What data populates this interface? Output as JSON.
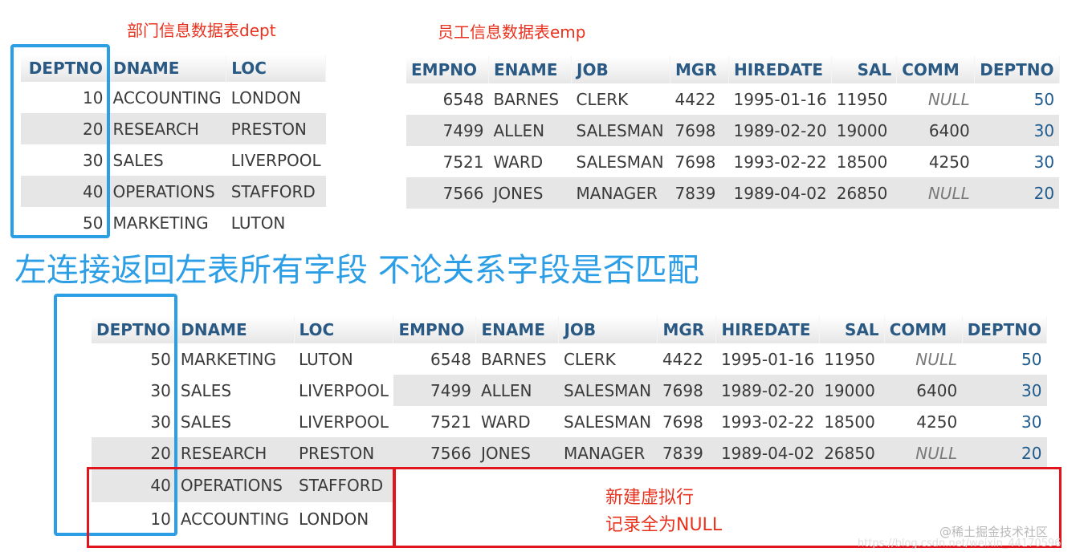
{
  "dept_title": "部门信息数据表dept",
  "emp_title": "员工信息数据表emp",
  "main_caption": "左连接返回左表所有字段 不论关系字段是否匹配",
  "note_line1": "新建虚拟行",
  "note_line2": "记录全为NULL",
  "watermark": "@稀土掘金技术社区",
  "watermark_url": "https://blog.csdn.net/weixin_44170596",
  "dept_table": {
    "headers": [
      "DEPTNO",
      "DNAME",
      "LOC"
    ],
    "rows": [
      [
        "10",
        "ACCOUNTING",
        "LONDON"
      ],
      [
        "20",
        "RESEARCH",
        "PRESTON"
      ],
      [
        "30",
        "SALES",
        "LIVERPOOL"
      ],
      [
        "40",
        "OPERATIONS",
        "STAFFORD"
      ],
      [
        "50",
        "MARKETING",
        "LUTON"
      ]
    ]
  },
  "emp_table": {
    "headers": [
      "EMPNO",
      "ENAME",
      "JOB",
      "MGR",
      "HIREDATE",
      "SAL",
      "COMM",
      "DEPTNO"
    ],
    "rows": [
      [
        "6548",
        "BARNES",
        "CLERK",
        "4422",
        "1995-01-16",
        "11950",
        "NULL",
        "50"
      ],
      [
        "7499",
        "ALLEN",
        "SALESMAN",
        "7698",
        "1989-02-20",
        "19000",
        "6400",
        "30"
      ],
      [
        "7521",
        "WARD",
        "SALESMAN",
        "7698",
        "1993-02-22",
        "18500",
        "4250",
        "30"
      ],
      [
        "7566",
        "JONES",
        "MANAGER",
        "7839",
        "1989-04-02",
        "26850",
        "NULL",
        "20"
      ]
    ]
  },
  "result_table": {
    "headers": [
      "DEPTNO",
      "DNAME",
      "LOC",
      "EMPNO",
      "ENAME",
      "JOB",
      "MGR",
      "HIREDATE",
      "SAL",
      "COMM",
      "DEPTNO"
    ],
    "rows": [
      [
        "50",
        "MARKETING",
        "LUTON",
        "6548",
        "BARNES",
        "CLERK",
        "4422",
        "1995-01-16",
        "11950",
        "NULL",
        "50"
      ],
      [
        "30",
        "SALES",
        "LIVERPOOL",
        "7499",
        "ALLEN",
        "SALESMAN",
        "7698",
        "1989-02-20",
        "19000",
        "6400",
        "30"
      ],
      [
        "30",
        "SALES",
        "LIVERPOOL",
        "7521",
        "WARD",
        "SALESMAN",
        "7698",
        "1993-02-22",
        "18500",
        "4250",
        "30"
      ],
      [
        "20",
        "RESEARCH",
        "PRESTON",
        "7566",
        "JONES",
        "MANAGER",
        "7839",
        "1989-04-02",
        "26850",
        "NULL",
        "20"
      ],
      [
        "40",
        "OPERATIONS",
        "STAFFORD"
      ],
      [
        "10",
        "ACCOUNTING",
        "LONDON"
      ]
    ]
  }
}
